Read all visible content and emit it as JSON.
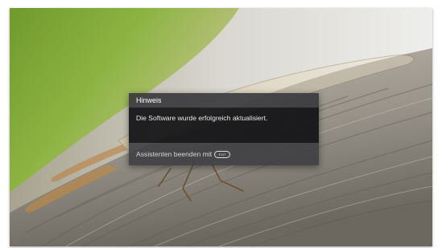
{
  "dialog": {
    "title": "Hinweis",
    "message": "Die Software wurde erfolgreich aktualisiert.",
    "footer_text": "Assistenten beenden mit",
    "footer_key_icon": "exit-key-icon",
    "footer_key_label": "EXIT"
  },
  "colors": {
    "header_bg": "#3a3a3e",
    "body_bg": "#121216",
    "footer_bg": "#3e3e42",
    "text": "#ffffff"
  }
}
